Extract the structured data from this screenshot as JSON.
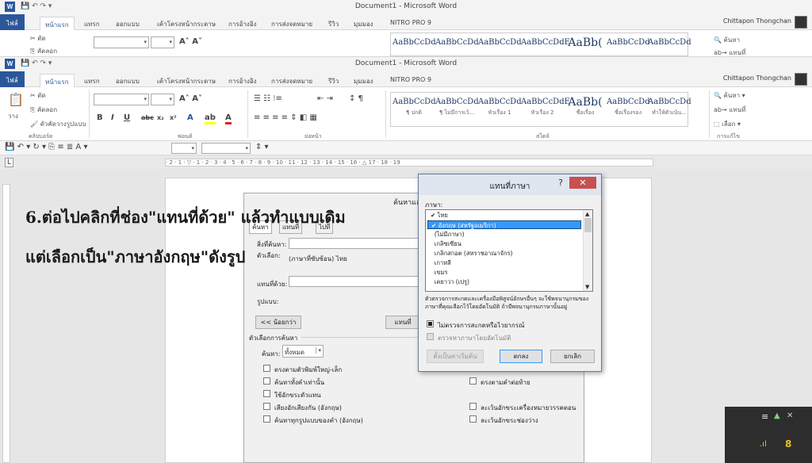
{
  "window": {
    "title": "Document1 - Microsoft Word",
    "user": "Chittapon Thongchan"
  },
  "tabs": [
    "ไฟล์",
    "หน้าแรก",
    "แทรก",
    "ออกแบบ",
    "เค้าโครงหน้ากระดาษ",
    "การอ้างอิง",
    "การส่งจดหมาย",
    "รีวิว",
    "มุมมอง",
    "NITRO PRO 9"
  ],
  "ribbon_top": {
    "cut": "ตัด",
    "copy": "คัดลอก",
    "find": "ค้นหา",
    "replace": "แทนที่"
  },
  "ribbon": {
    "paste": "วาง",
    "cut": "ตัด",
    "copy": "คัดลอก",
    "format_painter": "ตัวคัดวางรูปแบบ",
    "clipboard_label": "คลิปบอร์ด",
    "font_label": "ฟอนต์",
    "paragraph_label": "ย่อหน้า",
    "styles_label": "สไตล์",
    "editing_label": "การแก้ไข",
    "find": "ค้นหา",
    "replace": "แทนที่",
    "select": "เลือก",
    "styles": [
      {
        "name": "AaBbCcDd",
        "label": "¶ ปกติ"
      },
      {
        "name": "AaBbCcDd",
        "label": "¶ ไม่มีการเว้..."
      },
      {
        "name": "AaBbCcDd",
        "label": "หัวเรื่อง 1"
      },
      {
        "name": "AaBbCcDdE",
        "label": "หัวเรื่อง 2"
      },
      {
        "name": "AaBb(",
        "label": "ชื่อเรื่อง"
      },
      {
        "name": "AaBbCcDd",
        "label": "ชื่อเรื่องรอง"
      },
      {
        "name": "AaBbCcDd",
        "label": "ทำให้ตัวเน้น..."
      }
    ]
  },
  "caption": {
    "line1": "6.ต่อไปคลิกที่ช่อง\"แทนที่ด้วย\" แล้วทำแบบเดิม",
    "line2": "แต่เลือกเป็น\"ภาษาอังกฤษ\"ดังรูป"
  },
  "find_dialog": {
    "title": "ค้นหาและ",
    "tabs": [
      "ค้นหา",
      "แทนที่",
      "ไปที่"
    ],
    "find_what": "สิ่งที่ค้นหา:",
    "find_lang": "(ภาษาที่ซับซ้อน) ไทย",
    "replace_with": "แทนที่ด้วย:",
    "format": "รูปแบบ:",
    "less": "<< น้อยกว่า",
    "replace_btn": "แทนที่",
    "search_options": "ตัวเลือกการค้นหา",
    "search_label": "ค้นหา:",
    "search_value": "ทั้งหมด",
    "options_left": [
      "ตรงตามตัวพิมพ์ใหญ่-เล็ก",
      "ค้นหาทั้งคำเท่านั้น",
      "ใช้อักขระตัวแทน",
      "เสียงอักเสียงกัน (อังกฤษ)",
      "ค้นหาทุกรูปแบบของคำ (อังกฤษ)"
    ],
    "options_right": [
      "ตรงตามคำต่อท้าย",
      "ละเว้นอักขระเครื่องหมายวรรคตอน",
      "ละเว้นอักขระช่องว่าง"
    ]
  },
  "lang_dialog": {
    "title": "แทนที่ภาษา",
    "help": "?",
    "close": "✕",
    "language_label": "ภาษา:",
    "languages": [
      {
        "label": "ไทย",
        "checked": true,
        "selected": false
      },
      {
        "label": "อังกฤษ (สหรัฐอเมริกา)",
        "checked": true,
        "selected": true
      },
      {
        "label": "(ไม่มีภาษา)",
        "checked": false,
        "selected": false
      },
      {
        "label": "เกลิซเซียน",
        "checked": false,
        "selected": false
      },
      {
        "label": "เกลิกสกอต (สหราชอาณาจักร)",
        "checked": false,
        "selected": false
      },
      {
        "label": "เกาหลี",
        "checked": false,
        "selected": false
      },
      {
        "label": "เขมร",
        "checked": false,
        "selected": false
      },
      {
        "label": "เคยาวา (เปรู)",
        "checked": false,
        "selected": false
      }
    ],
    "note": "ตัวตรวจการสะกดและเครื่องมือพิสูจน์อักษรอื่นๆ จะใช้พจนานุกรมของภาษาที่คุณเลือกไว้โดยอัตโนมัติ ถ้ามีพจนานุกรมภาษานั้นอยู่",
    "no_proof": "ไม่ตรวจการสะกดหรือไวยากรณ์",
    "detect": "ตรวจหาภาษาโดยอัตโนมัติ",
    "default_btn": "ตั้งเป็นค่าเริ่มต้น",
    "ok": "ตกลง",
    "cancel": "ยกเลิก"
  },
  "tray": {
    "count": "8"
  }
}
